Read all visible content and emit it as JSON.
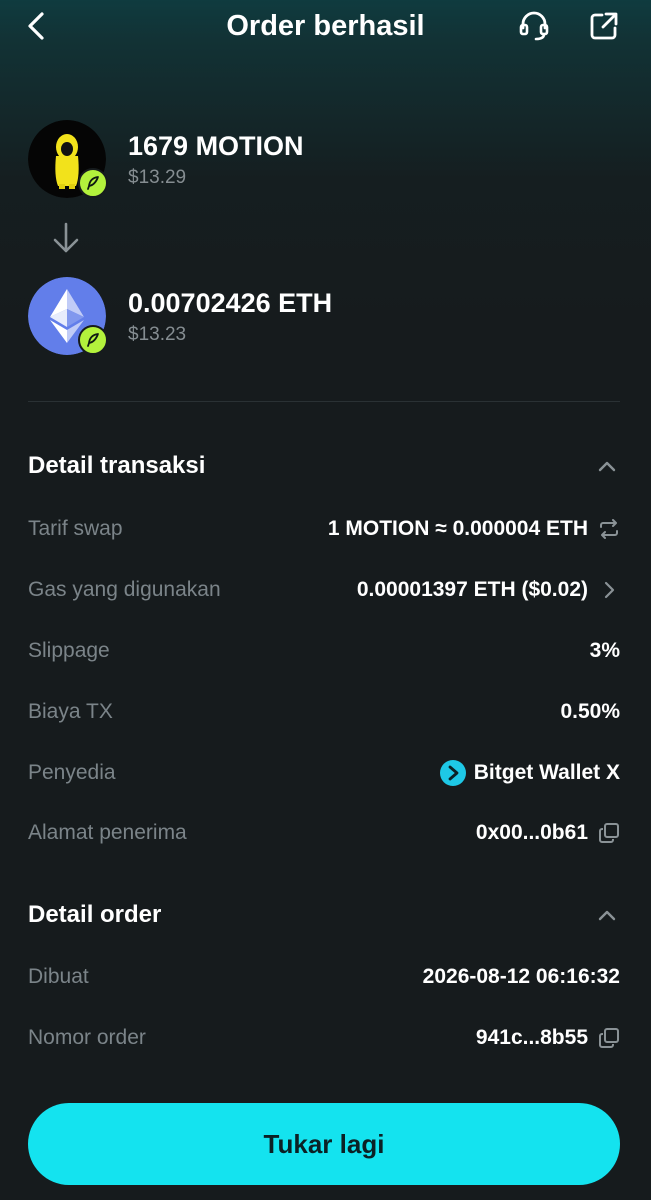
{
  "header": {
    "title": "Order berhasil"
  },
  "swap": {
    "from": {
      "amount": "1679 MOTION",
      "fiat": "$13.29"
    },
    "to": {
      "amount": "0.00702426 ETH",
      "fiat": "$13.23"
    }
  },
  "transaction_details": {
    "title": "Detail transaksi",
    "rows": [
      {
        "label": "Tarif swap",
        "value": "1 MOTION ≈ 0.000004 ETH"
      },
      {
        "label": "Gas yang digunakan",
        "value": "0.00001397 ETH ($0.02)"
      },
      {
        "label": "Slippage",
        "value": "3%"
      },
      {
        "label": "Biaya TX",
        "value": "0.50%"
      },
      {
        "label": "Penyedia",
        "value": "Bitget Wallet X"
      },
      {
        "label": "Alamat penerima",
        "value": "0x00...0b61"
      }
    ]
  },
  "order_details": {
    "title": "Detail order",
    "rows": [
      {
        "label": "Dibuat",
        "value": "2026-08-12 06:16:32"
      },
      {
        "label": "Nomor order",
        "value": "941c...8b55"
      }
    ]
  },
  "cta": {
    "label": "Tukar lagi"
  },
  "colors": {
    "accent": "#14e3ef",
    "background": "#161b1d",
    "muted_text": "#7b8489",
    "badge": "#b3f23c",
    "eth": "#627eea"
  },
  "icons": [
    "back-icon",
    "headset-icon",
    "share-icon",
    "arrow-down-icon",
    "chevron-up-icon",
    "swap-arrows-icon",
    "chevron-right-icon",
    "bitget-wallet-icon",
    "copy-icon"
  ]
}
